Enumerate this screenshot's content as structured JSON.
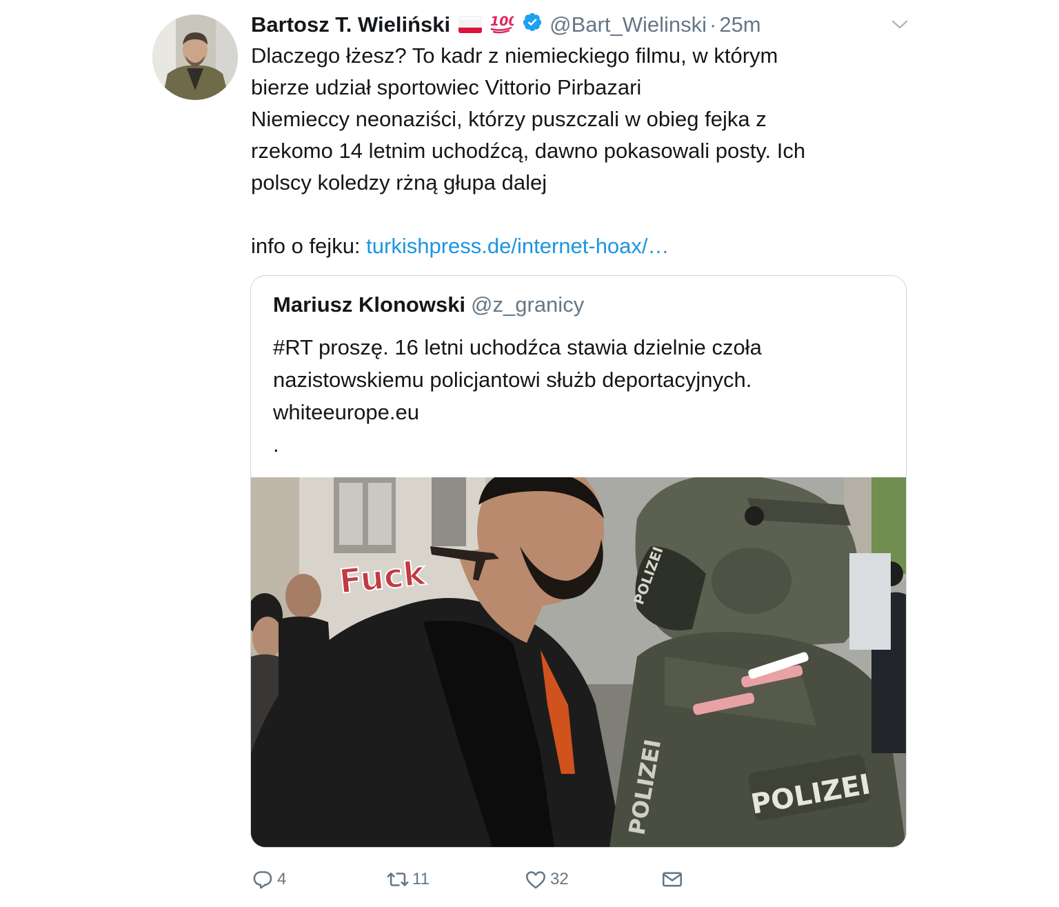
{
  "author": {
    "name": "Bartosz T. Wieliński",
    "handle": "@Bart_Wielinski",
    "separator": "·",
    "time": "25m",
    "emoji_flag": "flag-poland-icon",
    "emoji_badge": "hundred-points-icon",
    "verified": true
  },
  "tweet": {
    "lines": [
      "Dlaczego łżesz? To kadr z niemieckiego filmu, w którym",
      "bierze udział sportowiec Vittorio Pirbazari",
      "Niemieccy neonaziści, którzy puszczali w obieg fejka z",
      "rzekomo 14 letnim uchodźcą, dawno pokasowali posty. Ich",
      "polscy koledzy rżną głupa dalej"
    ],
    "info_prefix": "info o fejku: ",
    "info_link": "turkishpress.de/internet-hoax/…"
  },
  "quoted": {
    "name": "Mariusz Klonowski",
    "handle": "@z_granicy",
    "lines": [
      "#RT proszę. 16 letni uchodźca stawia dzielnie czoła",
      "nazistowskiemu policjantowi służb deportacyjnych.",
      "whiteeurope.eu",
      "."
    ],
    "image": {
      "neck_tattoo": "rifle-tattoo",
      "graffiti": "Fuck",
      "helmet_patch": "POLIZEI",
      "back_patch": "POLIZEI",
      "side_patch": "POLIZEI"
    }
  },
  "actions": {
    "reply_count": "4",
    "retweet_count": "11",
    "like_count": "32"
  },
  "colors": {
    "text": "#14171a",
    "secondary": "#657786",
    "link": "#1b95e0",
    "border": "#ccd6dd",
    "verified": "#1da1f2"
  }
}
